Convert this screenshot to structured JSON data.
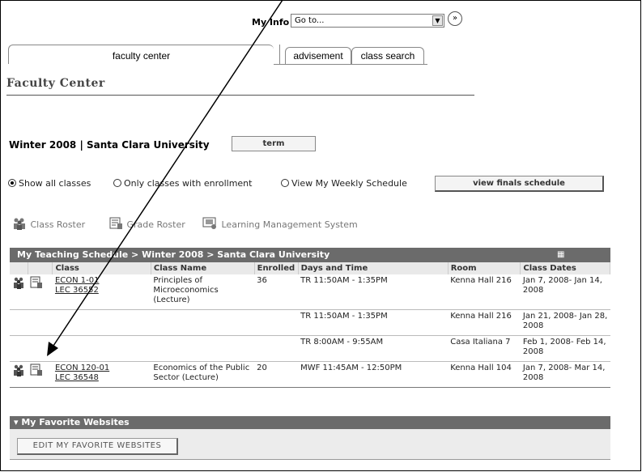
{
  "header": {
    "myinfo_label": "My Info",
    "goto_value": "Go to...",
    "go_glyph": "»"
  },
  "tabs": [
    {
      "label": "faculty center",
      "active": true
    },
    {
      "label": "advisement",
      "active": false
    },
    {
      "label": "class search",
      "active": false
    }
  ],
  "page_title": "Faculty Center",
  "term": {
    "text": "Winter 2008 | Santa Clara University",
    "button_label": "term"
  },
  "filters": {
    "options": [
      {
        "label": "Show all classes",
        "selected": true
      },
      {
        "label": "Only classes with enrollment",
        "selected": false
      },
      {
        "label": "View My Weekly Schedule",
        "selected": false
      }
    ],
    "finals_button": "view finals schedule"
  },
  "legend": {
    "items": [
      {
        "label": "Class Roster",
        "icon": "class-roster-icon"
      },
      {
        "label": "Grade Roster",
        "icon": "grade-roster-icon"
      },
      {
        "label": "Learning Management System",
        "icon": "lms-icon"
      }
    ]
  },
  "schedule": {
    "title": "My Teaching Schedule > Winter 2008 > Santa Clara University",
    "columns": [
      "Class",
      "Class Name",
      "Enrolled",
      "Days and Time",
      "Room",
      "Class Dates"
    ],
    "rows": [
      {
        "class": "ECON 1-01",
        "section": "LEC 36552",
        "name": "Principles of Microeconomics (Lecture)",
        "enrolled": "36",
        "time": "TR 11:50AM - 1:35PM",
        "room": "Kenna Hall 216",
        "dates": "Jan 7, 2008- Jan 14, 2008"
      },
      {
        "class": "",
        "section": "",
        "name": "",
        "enrolled": "",
        "time": "TR 11:50AM - 1:35PM",
        "room": "Kenna Hall 216",
        "dates": "Jan 21, 2008- Jan 28, 2008"
      },
      {
        "class": "",
        "section": "",
        "name": "",
        "enrolled": "",
        "time": "TR 8:00AM - 9:55AM",
        "room": "Casa Italiana 7",
        "dates": "Feb 1, 2008- Feb 14, 2008"
      },
      {
        "class": "ECON 120-01",
        "section": "LEC 36548",
        "name": "Economics of the Public Sector (Lecture)",
        "enrolled": "20",
        "time": "MWF 11:45AM - 12:50PM",
        "room": "Kenna Hall 104",
        "dates": "Jan 7, 2008- Mar 14, 2008"
      }
    ]
  },
  "favorites": {
    "title": "My Favorite Websites",
    "edit_button": "EDIT MY FAVORITE WEBSITES"
  }
}
